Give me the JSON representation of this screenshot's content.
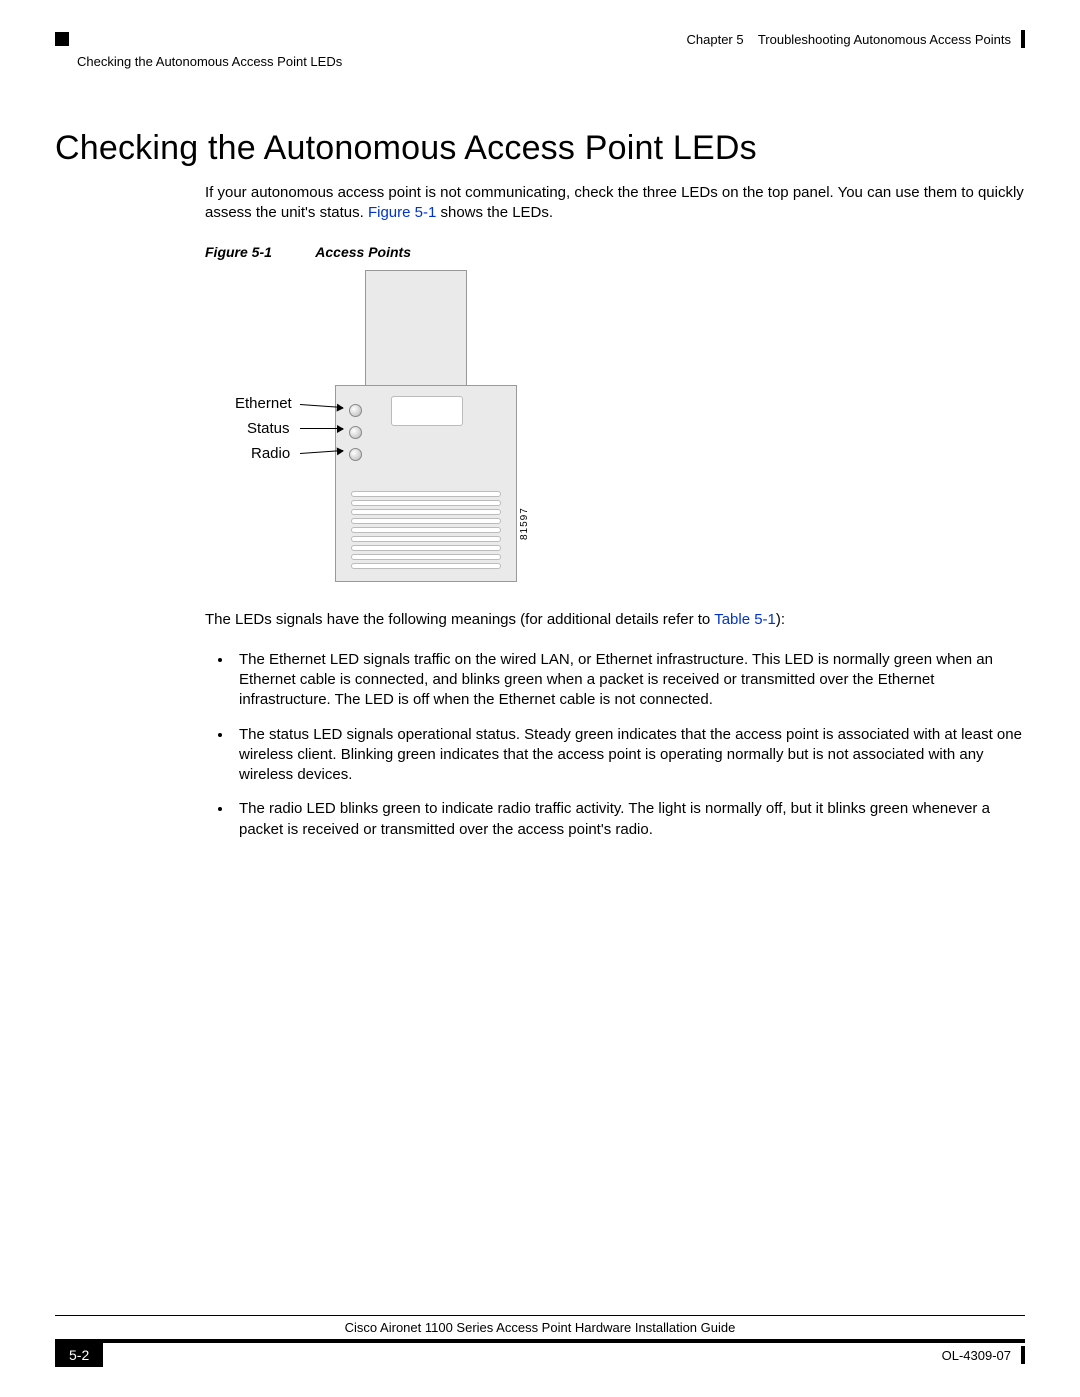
{
  "header": {
    "chapter_label": "Chapter 5",
    "chapter_title": "Troubleshooting Autonomous Access Points",
    "section_crumb": "Checking the Autonomous Access Point LEDs"
  },
  "title": "Checking the Autonomous Access Point LEDs",
  "intro": {
    "pre": "If your autonomous access point is not communicating, check the three LEDs on the top panel. You can use them to quickly assess the unit's status. ",
    "figref": "Figure 5-1",
    "post": " shows the LEDs."
  },
  "figure": {
    "label": "Figure 5-1",
    "caption": "Access Points",
    "leds": {
      "ethernet": "Ethernet",
      "status": "Status",
      "radio": "Radio"
    },
    "id": "81597"
  },
  "meanings": {
    "pre": "The LEDs signals have the following meanings (for additional details refer to ",
    "tableref": "Table 5-1",
    "post": "):"
  },
  "bullets": [
    "The Ethernet LED signals traffic on the wired LAN, or Ethernet infrastructure. This LED is normally green when an Ethernet cable is connected, and blinks green when a packet is received or transmitted over the Ethernet infrastructure. The LED is off when the Ethernet cable is not connected.",
    "The status LED signals operational status. Steady green indicates that the access point is associated with at least one wireless client. Blinking green indicates that the access point is operating normally but is not associated with any wireless devices.",
    "The radio LED blinks green to indicate radio traffic activity. The light is normally off, but it blinks green whenever a packet is received or transmitted over the access point's radio."
  ],
  "footer": {
    "guide": "Cisco Aironet 1100 Series Access Point Hardware Installation Guide",
    "page": "5-2",
    "docid": "OL-4309-07"
  }
}
